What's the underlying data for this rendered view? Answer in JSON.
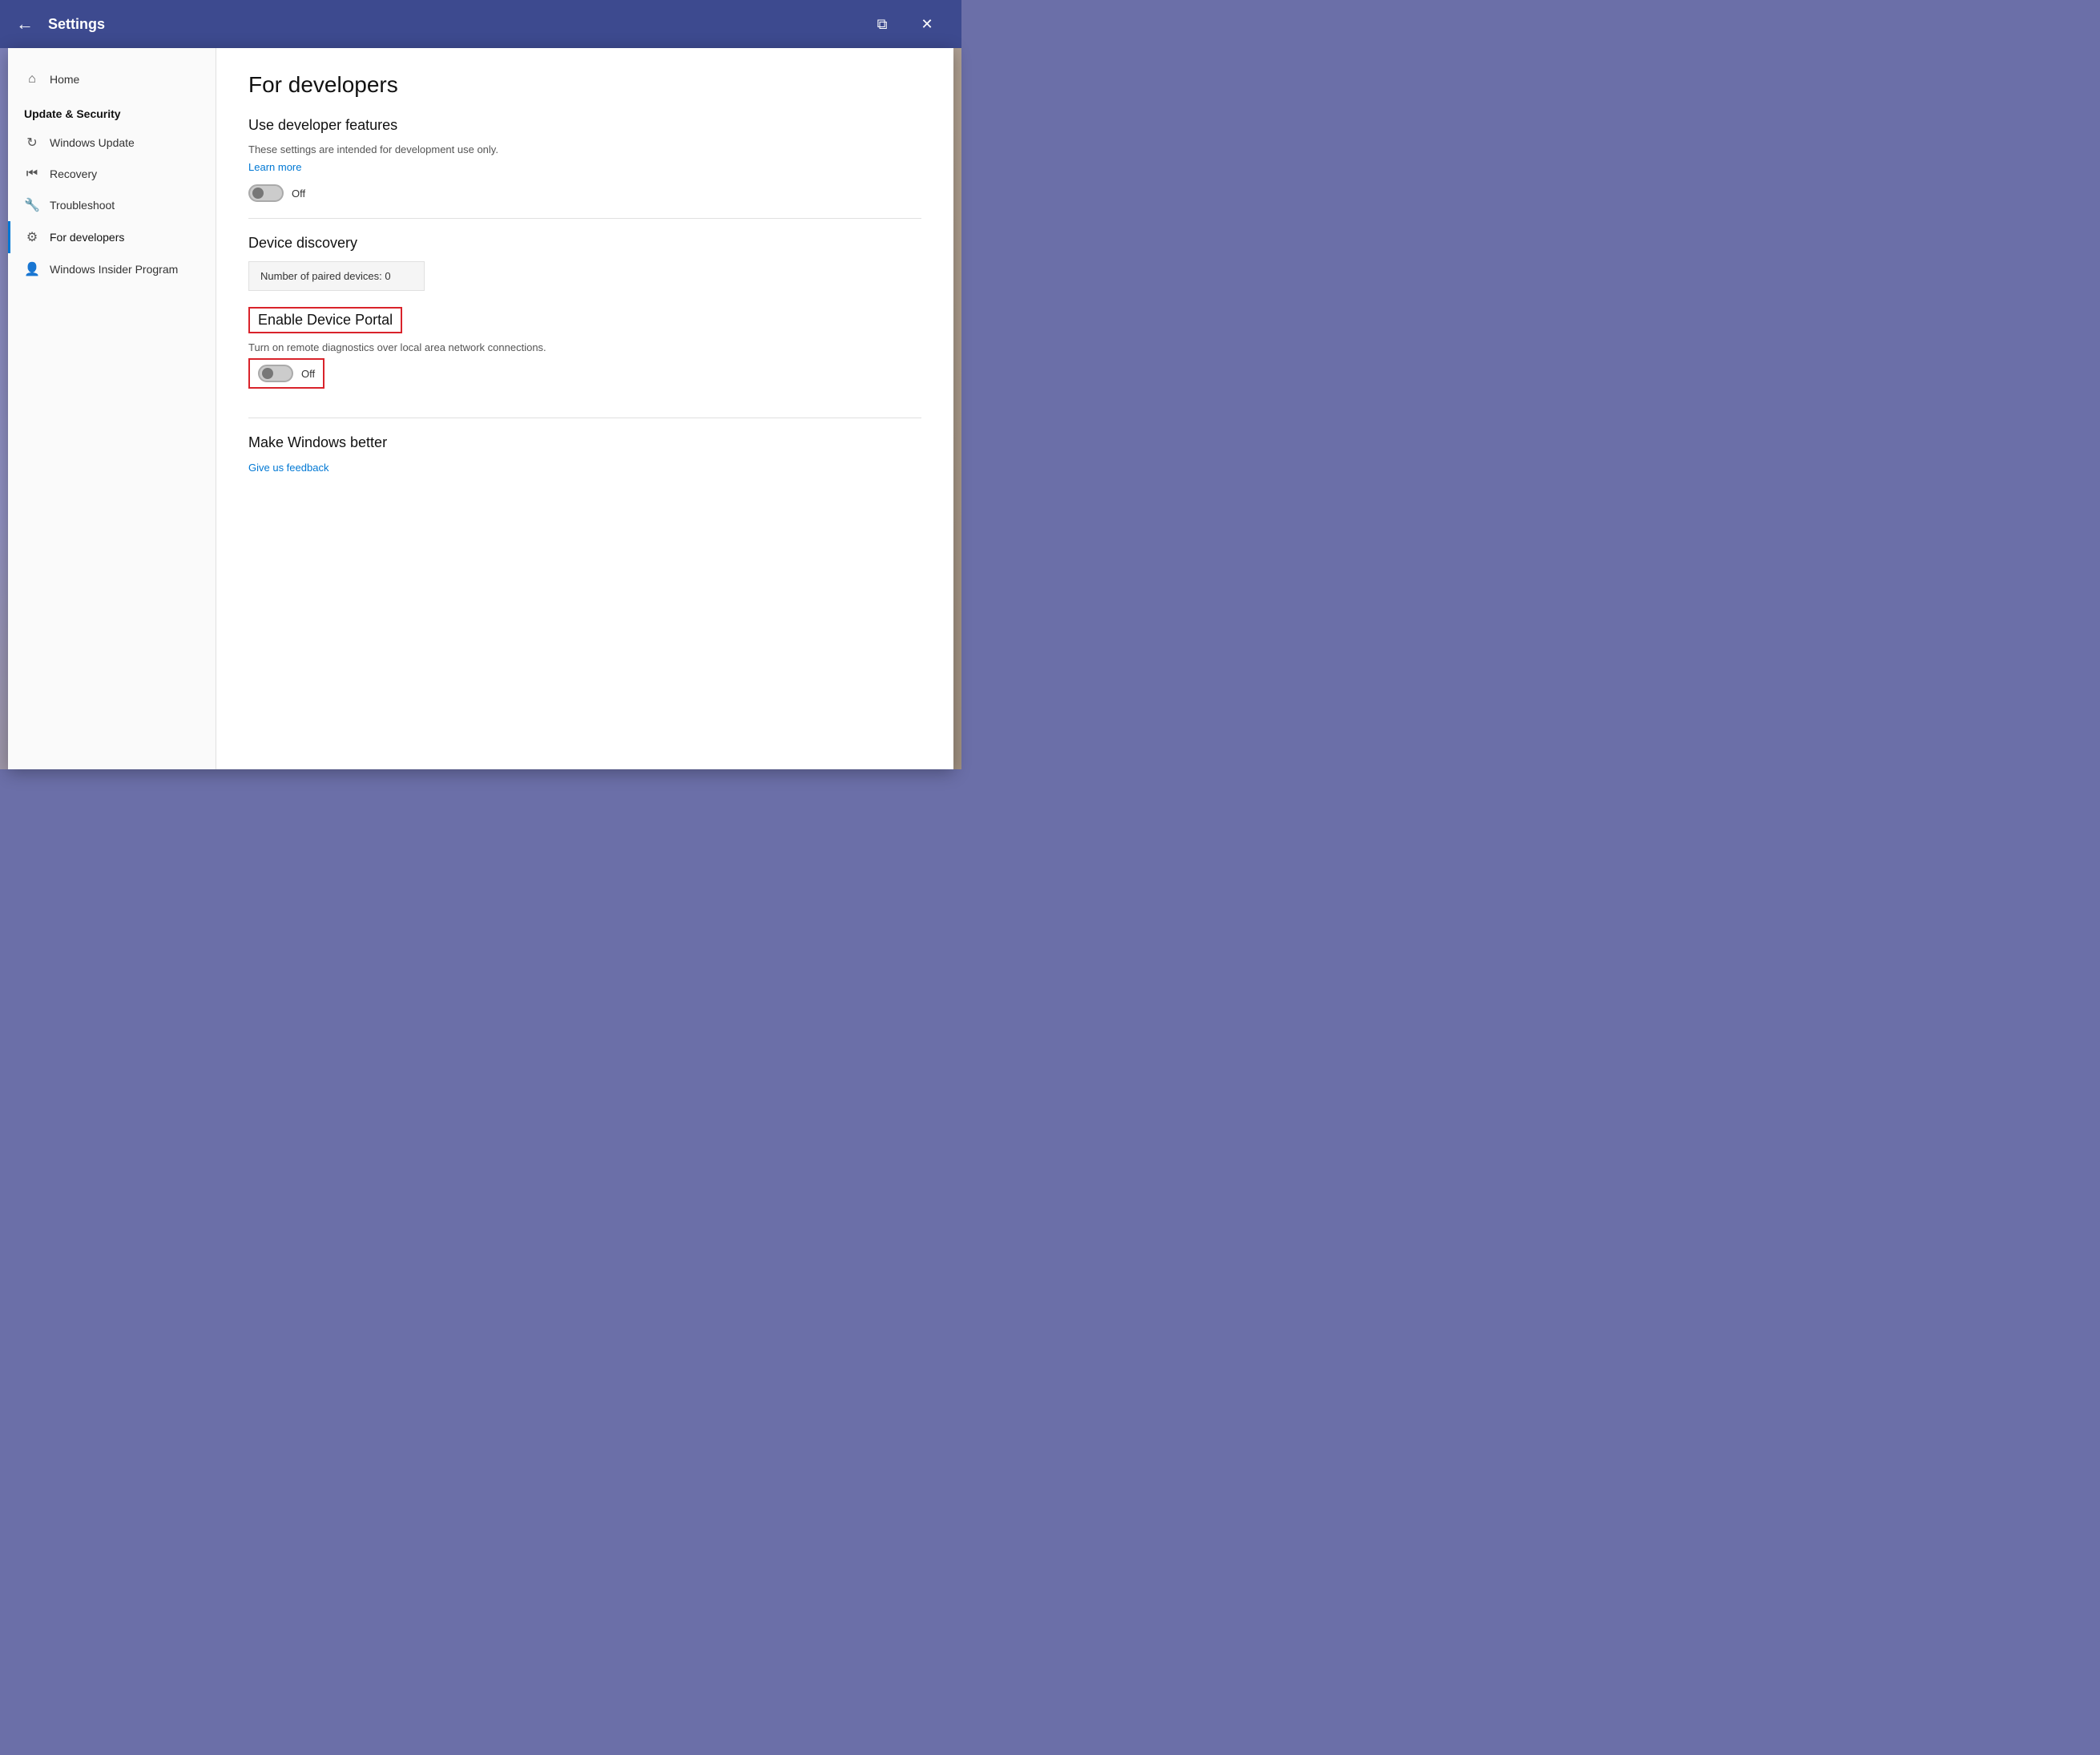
{
  "titleBar": {
    "title": "Settings",
    "backBtn": "←",
    "snapBtn": "⧉",
    "closeBtn": "✕"
  },
  "sidebar": {
    "homeLabel": "Home",
    "sectionTitle": "Update & Security",
    "items": [
      {
        "id": "windows-update",
        "label": "Windows Update",
        "icon": "↻"
      },
      {
        "id": "recovery",
        "label": "Recovery",
        "icon": "⏮"
      },
      {
        "id": "troubleshoot",
        "label": "Troubleshoot",
        "icon": "🔧"
      },
      {
        "id": "for-developers",
        "label": "For developers",
        "icon": "⚙",
        "active": true
      },
      {
        "id": "windows-insider",
        "label": "Windows Insider Program",
        "icon": "👤"
      }
    ]
  },
  "content": {
    "pageTitle": "For developers",
    "sections": {
      "useDeveloperFeatures": {
        "title": "Use developer features",
        "desc": "These settings are intended for development use only.",
        "learnMore": "Learn more",
        "toggleLabel": "Off"
      },
      "deviceDiscovery": {
        "title": "Device discovery",
        "pairedDevices": "Number of paired devices: 0"
      },
      "enableDevicePortal": {
        "title": "Enable Device Portal",
        "desc": "Turn on remote diagnostics over local area network connections.",
        "toggleLabel": "Off"
      },
      "makeWindowsBetter": {
        "title": "Make Windows better",
        "feedbackLink": "Give us feedback"
      }
    }
  }
}
